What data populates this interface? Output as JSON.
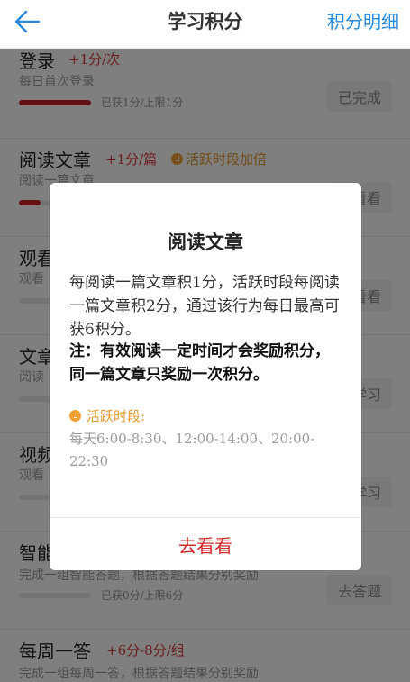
{
  "header": {
    "title": "学习积分",
    "right_link": "积分明细"
  },
  "tasks": [
    {
      "name": "登录",
      "points": "+1分/次",
      "desc": "每日首次登录",
      "progress_text": "已获1分/上限1分",
      "progress": 1.0,
      "button": "已完成"
    },
    {
      "name": "阅读文章",
      "points": "+1分/篇",
      "bonus": "活跃时段加倍",
      "desc": "阅读一篇文章",
      "progress": 0.3,
      "button": "去看看"
    },
    {
      "name": "观看",
      "desc": "观看",
      "button": "去看看"
    },
    {
      "name": "文章",
      "desc": "阅读",
      "button": "去学习"
    },
    {
      "name": "视频",
      "desc": "观看",
      "button": "去学习"
    },
    {
      "name": "智能",
      "desc": "完成一组智能答题，根据答题结果分别奖励",
      "progress_text": "已获0分/上限6分",
      "progress": 0.0,
      "button": "去答题"
    },
    {
      "name": "每周一答",
      "points": "+6分-8分/组",
      "desc": "完成一组每周一答，根据答题结果分别奖励"
    }
  ],
  "dialog": {
    "title": "阅读文章",
    "body": "每阅读一篇文章积1分，活跃时段每阅读一篇文章积2分，通过该行为每日最高可获6积分。",
    "note": "注：有效阅读一定时间才会奖励积分，同一篇文章只奖励一次积分。",
    "active_label": "活跃时段:",
    "active_times": "每天6:00-8:30、12:00-14:00、20:00-22:30",
    "action": "去看看"
  },
  "colors": {
    "accent_blue": "#2a8bdc",
    "points_red": "#d9383c",
    "bonus_orange": "#e59a2d",
    "progress_red": "#c8202b",
    "action_red": "#d22a2a"
  }
}
